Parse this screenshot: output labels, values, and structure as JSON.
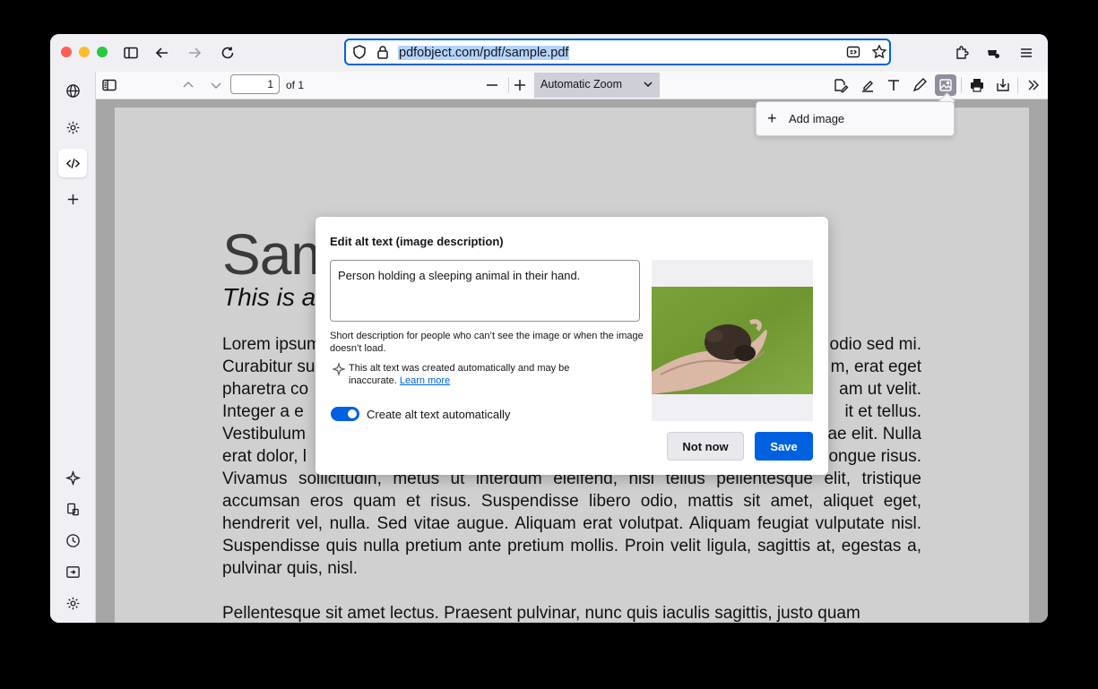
{
  "browser": {
    "url": "pdfobject.com/pdf/sample.pdf",
    "icons": [
      "sidebar-toggle-icon",
      "back-arrow-icon",
      "forward-arrow-icon",
      "reload-icon",
      "shield-icon",
      "lock-icon",
      "reader-view-icon",
      "bookmark-star-icon",
      "extensions-icon",
      "profile-icon",
      "menu-icon"
    ]
  },
  "sidebar": {
    "icons": [
      "globe-icon",
      "gear-icon",
      "code-icon",
      "plus-icon",
      "ai-sparkle-icon",
      "sync-icon",
      "history-icon",
      "tabs-icon",
      "settings-icon"
    ]
  },
  "pdf_toolbar": {
    "page_number": "1",
    "of_pages": "of 1",
    "zoom": "Automatic Zoom"
  },
  "add_image_menu": {
    "label": "Add image"
  },
  "pdf_page": {
    "title": "Sam",
    "subtitle": "This is a",
    "paragraph1_lines": [
      "Lorem ipsum",
      "odio sed mi.",
      "Curabitur su",
      "m, erat eget",
      "pharetra co",
      "am ut velit.",
      "Integer a e",
      "it et tellus.",
      "Vestibulum",
      "ae elit. Nulla",
      "erat dolor, l",
      "ongue risus.",
      "Vivamus sollicitudin, metus ut interdum eleifend, nisi tellus pellentesque elit, tristique accumsan eros quam et risus. Suspendisse libero odio, mattis sit amet, aliquet eget, hendrerit vel, nulla. Sed vitae augue. Aliquam erat volutpat. Aliquam feugiat vulputate nisl. Suspendisse quis nulla pretium ante pretium mollis. Proin velit ligula, sagittis at, egestas a, pulvinar quis, nisl."
    ],
    "paragraph2": "Pellentesque sit amet lectus. Praesent pulvinar, nunc quis iaculis sagittis, justo quam"
  },
  "alt_text_dialog": {
    "title": "Edit alt text (image description)",
    "textarea_value": "Person holding a sleeping animal in their hand.",
    "hint": "Short description for people who can’t see the image or when the image doesn’t load.",
    "auto_notice": "This alt text was created automatically and may be inaccurate.",
    "learn_more": "Learn more",
    "toggle_label": "Create alt text automatically",
    "toggle_on": true,
    "not_now": "Not now",
    "save": "Save",
    "accent_color": "#0061e0"
  }
}
